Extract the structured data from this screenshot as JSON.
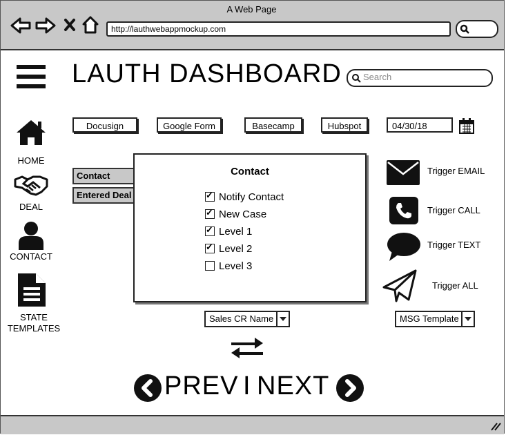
{
  "window": {
    "title": "A Web Page",
    "url": "http://lauthwebappmockup.com"
  },
  "header": {
    "title": "LAUTH DASHBOARD",
    "search_placeholder": "Search"
  },
  "sidebar": {
    "items": [
      {
        "label": "HOME",
        "icon": "home-icon"
      },
      {
        "label": "DEAL",
        "icon": "handshake-icon"
      },
      {
        "label": "CONTACT",
        "icon": "user-icon"
      },
      {
        "label_line1": "STATE",
        "label_line2": "TEMPLATES",
        "icon": "document-icon"
      }
    ]
  },
  "toolbar": {
    "links": [
      "Docusign",
      "Google Form",
      "Basecamp",
      "Hubspot"
    ],
    "date": "04/30/18"
  },
  "tabs": [
    "Contact",
    "Entered Deal"
  ],
  "modal": {
    "title": "Contact",
    "options": [
      {
        "label": "Notify Contact",
        "checked": true
      },
      {
        "label": "New Case",
        "checked": true
      },
      {
        "label": "Level 1",
        "checked": true
      },
      {
        "label": "Level 2",
        "checked": true
      },
      {
        "label": "Level 3",
        "checked": false
      }
    ]
  },
  "triggers": [
    "Trigger EMAIL",
    "Trigger CALL",
    "Trigger TEXT",
    "Trigger ALL"
  ],
  "selects": {
    "sales": "Sales CR Name",
    "template": "MSG Template"
  },
  "pager": {
    "prev": "PREV",
    "separator": "I",
    "next": "NEXT"
  }
}
